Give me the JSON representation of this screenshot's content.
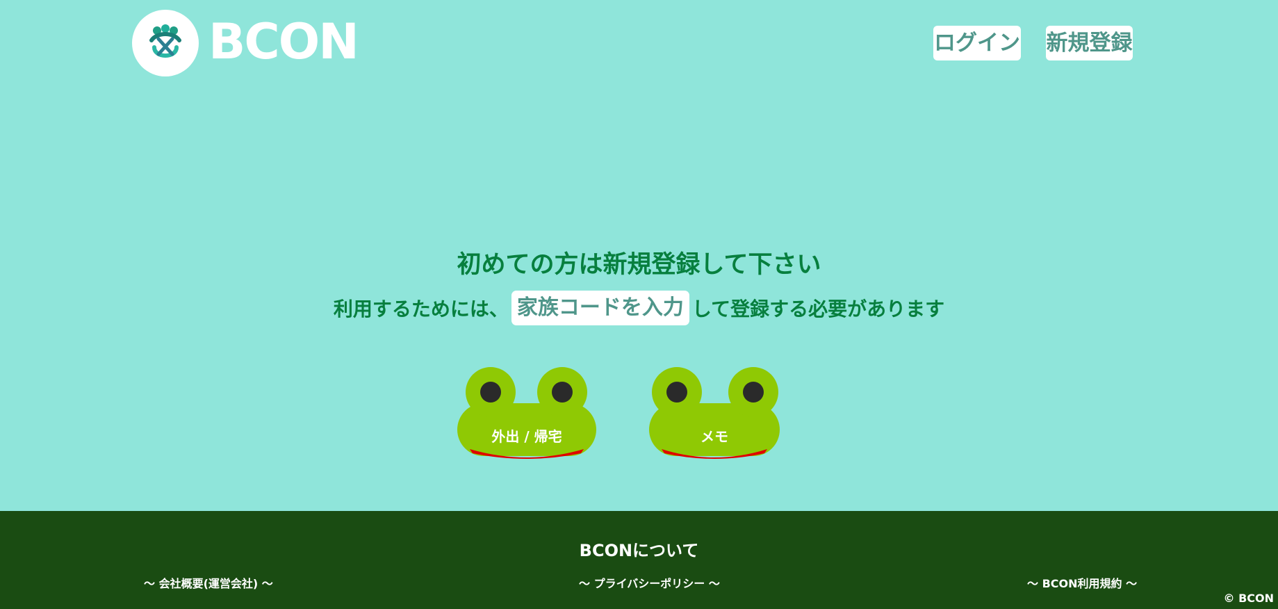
{
  "header": {
    "logo_text": "BCON",
    "logo_icon": "frog-family-logo-icon",
    "login_label": "ログイン",
    "signup_label": "新規登録"
  },
  "main": {
    "headline": "初めての方は新規登録して下さい",
    "sub_before": "利用するためには、",
    "family_code_button": "家族コードを入力",
    "sub_after": "して登録する必要があります",
    "frog_buttons": [
      {
        "label": "外出 / 帰宅",
        "icon": "frog-icon"
      },
      {
        "label": "メモ",
        "icon": "frog-icon"
      }
    ]
  },
  "footer": {
    "title": "BCONについて",
    "links": [
      "〜 会社概要(運営会社) 〜",
      "〜 プライバシーポリシー 〜",
      "〜 BCON利用規約 〜"
    ],
    "copyright": "© BCON"
  },
  "colors": {
    "background": "#8fe5da",
    "headline_text": "#077f3e",
    "button_text": "#4f968a",
    "frog_green": "#8fc904",
    "frog_mouth": "#e00000",
    "footer_bg": "#1a4c12"
  }
}
